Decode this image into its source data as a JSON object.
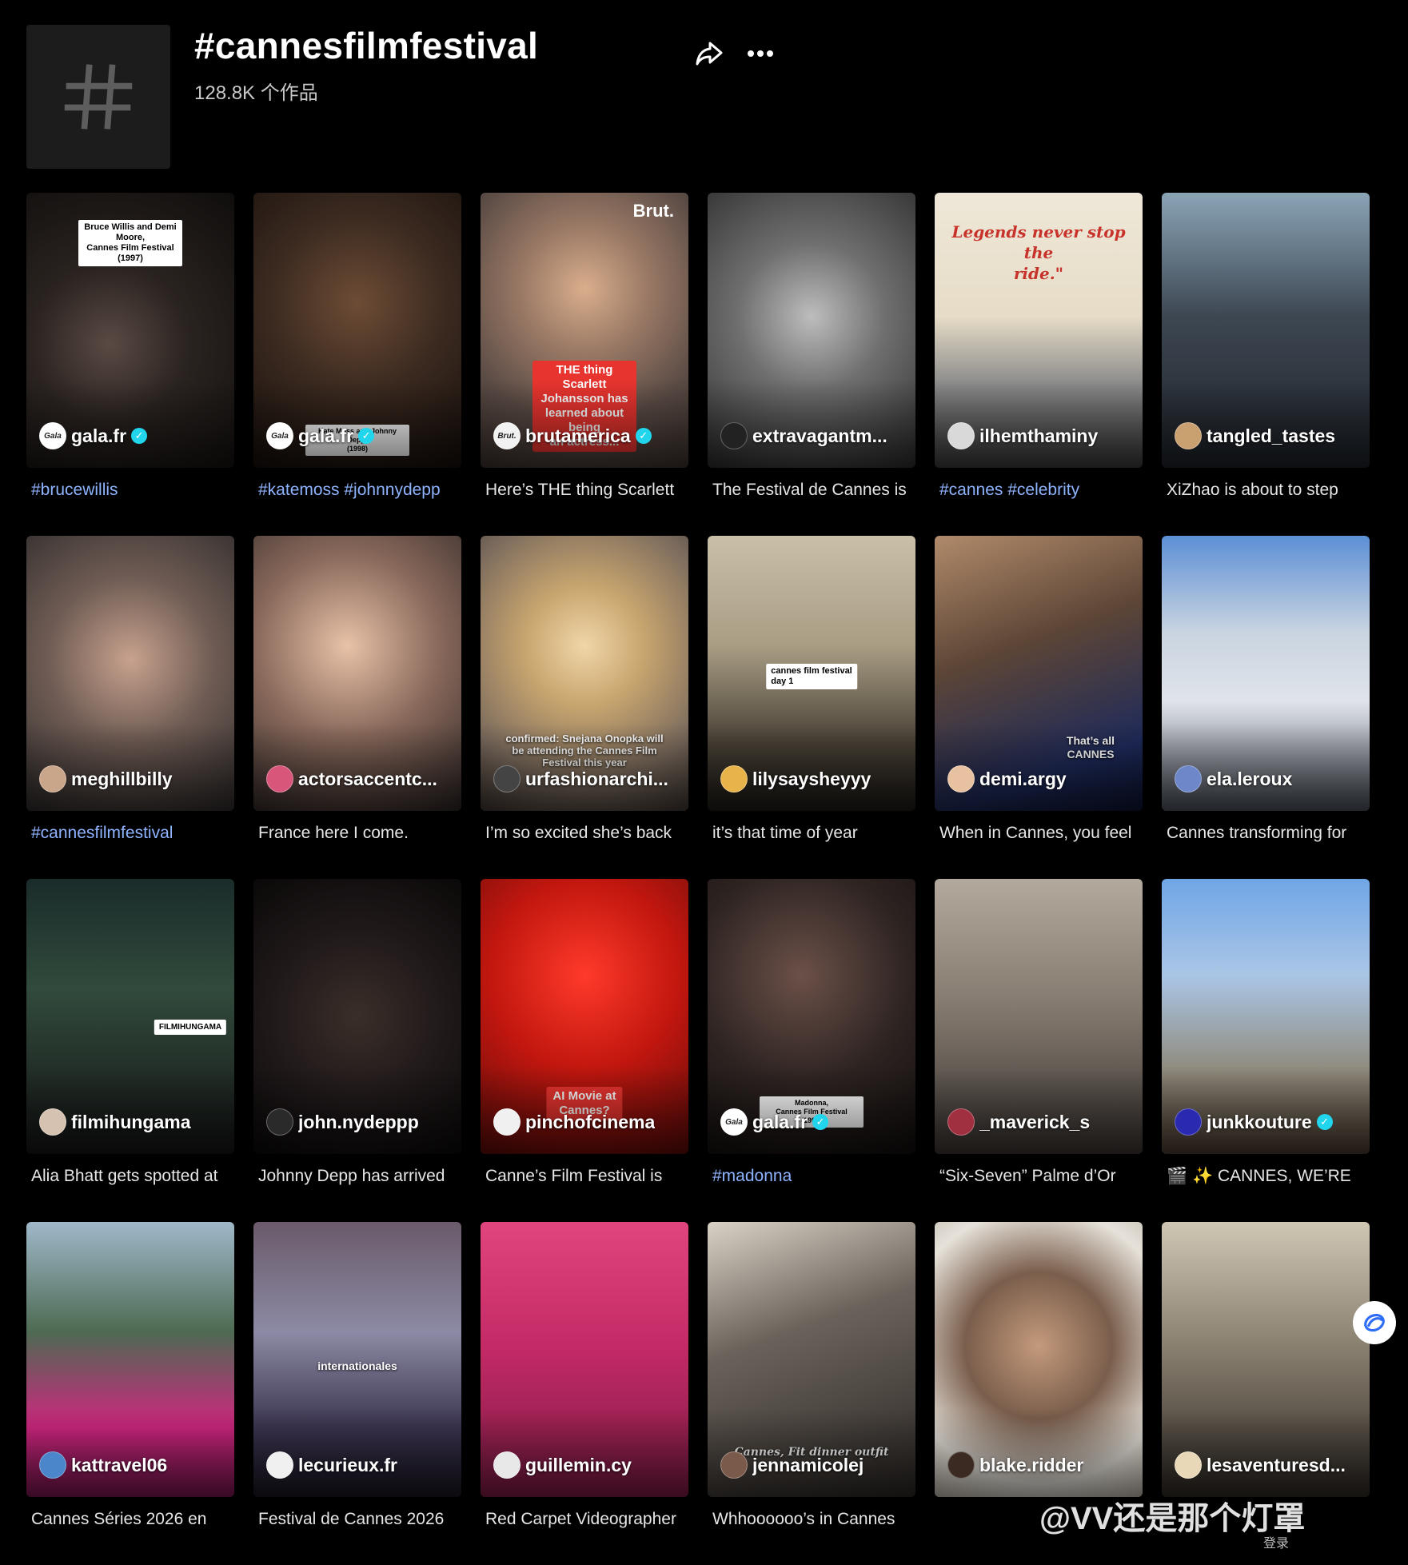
{
  "header": {
    "title": "#cannesfilmfestival",
    "count": "128.8K 个作品"
  },
  "colors": {
    "hashtag": "#8fb4ff",
    "verified": "#20d5ec",
    "background": "#000000"
  },
  "cards": [
    {
      "username": "gala.fr",
      "verified": true,
      "caption": "#brucewillis",
      "caption_is_tag": true,
      "avatar_text": "Gala",
      "overlay": "Bruce Willis and Demi Moore,\nCannes Film Festival (1997)"
    },
    {
      "username": "gala.fr",
      "verified": true,
      "caption": "#katemoss #johnnydepp",
      "caption_is_tag": true,
      "avatar_text": "Gala",
      "overlay": "Kate Moss and Johnny Depp,\n(1998)"
    },
    {
      "username": "brutamerica",
      "verified": true,
      "caption": "Here’s THE thing Scarlett",
      "caption_is_tag": false,
      "avatar_text": "Brut.",
      "brand": "Brut.",
      "overlay": "THE thing\nScarlett Johansson has\nlearned about being\nan actress..."
    },
    {
      "username": "extravagantm...",
      "verified": false,
      "caption": "The Festival de Cannes is",
      "caption_is_tag": false,
      "avatar_text": "",
      "overlay": ""
    },
    {
      "username": "ilhemthaminy",
      "verified": false,
      "caption": "#cannes #celebrity",
      "caption_is_tag": true,
      "avatar_text": "",
      "overlay": "Legends never stop the\nride.\""
    },
    {
      "username": "tangled_tastes",
      "verified": false,
      "caption": "XiZhao is about to step",
      "caption_is_tag": false,
      "avatar_text": "",
      "overlay": ""
    },
    {
      "username": "meghillbilly",
      "verified": false,
      "caption": "#cannesfilmfestival",
      "caption_is_tag": true,
      "avatar_text": "",
      "overlay": ""
    },
    {
      "username": "actorsaccentc...",
      "verified": false,
      "caption": "France here I come.",
      "caption_is_tag": false,
      "avatar_text": "",
      "overlay": ""
    },
    {
      "username": "urfashionarchi...",
      "verified": false,
      "caption": "I’m so excited she’s back",
      "caption_is_tag": false,
      "avatar_text": "",
      "overlay": "confirmed: Snejana Onopka will\nbe attending the Cannes Film\nFestival this year"
    },
    {
      "username": "lilysaysheyyy",
      "verified": false,
      "caption": "it’s that time of year",
      "caption_is_tag": false,
      "avatar_text": "",
      "overlay": "cannes film festival\nday 1"
    },
    {
      "username": "demi.argy",
      "verified": false,
      "caption": "When in Cannes, you feel",
      "caption_is_tag": false,
      "avatar_text": "",
      "overlay": "That’s all\nCANNES"
    },
    {
      "username": "ela.leroux",
      "verified": false,
      "caption": "Cannes transforming for",
      "caption_is_tag": false,
      "avatar_text": "",
      "overlay": ""
    },
    {
      "username": "filmihungama",
      "verified": false,
      "caption": "Alia Bhatt gets spotted at",
      "caption_is_tag": false,
      "avatar_text": "",
      "overlay": "FILMIHUNGAMA"
    },
    {
      "username": "john.nydeppp",
      "verified": false,
      "caption": "Johnny Depp has arrived",
      "caption_is_tag": false,
      "avatar_text": "",
      "overlay": ""
    },
    {
      "username": "pinchofcinema",
      "verified": false,
      "caption": "Canne’s Film Festival is",
      "caption_is_tag": false,
      "avatar_text": "",
      "overlay": "AI Movie at\nCannes?"
    },
    {
      "username": "gala.fr",
      "verified": true,
      "caption": "#madonna",
      "caption_is_tag": true,
      "avatar_text": "Gala",
      "overlay": "Madonna,\nCannes Film Festival (1991)"
    },
    {
      "username": "_maverick_s",
      "verified": false,
      "caption": "“Six-Seven” Palme d’Or",
      "caption_is_tag": false,
      "avatar_text": "",
      "overlay": ""
    },
    {
      "username": "junkkouture",
      "verified": true,
      "caption": "🎬 ✨ CANNES, WE’RE",
      "caption_is_tag": false,
      "avatar_text": "",
      "overlay": ""
    },
    {
      "username": "kattravel06",
      "verified": false,
      "caption": "Cannes Séries 2026 en",
      "caption_is_tag": false,
      "avatar_text": "",
      "overlay": ""
    },
    {
      "username": "lecurieux.fr",
      "verified": false,
      "caption": "Festival de Cannes 2026",
      "caption_is_tag": false,
      "avatar_text": "",
      "overlay": "internationales"
    },
    {
      "username": "guillemin.cy",
      "verified": false,
      "caption": "Red Carpet Videographer",
      "caption_is_tag": false,
      "avatar_text": "",
      "overlay": ""
    },
    {
      "username": "jennamicolej",
      "verified": false,
      "caption": "Whhoooooo’s in Cannes",
      "caption_is_tag": false,
      "avatar_text": "",
      "overlay": "Cannes, Fit dinner outfit"
    },
    {
      "username": "blake.ridder",
      "verified": false,
      "caption": "",
      "caption_is_tag": false,
      "avatar_text": "",
      "overlay": ""
    },
    {
      "username": "lesaventuresd...",
      "verified": false,
      "caption": "",
      "caption_is_tag": false,
      "avatar_text": "",
      "overlay": ""
    }
  ],
  "watermark": "@VV还是那个灯罩",
  "login_label": "登录"
}
